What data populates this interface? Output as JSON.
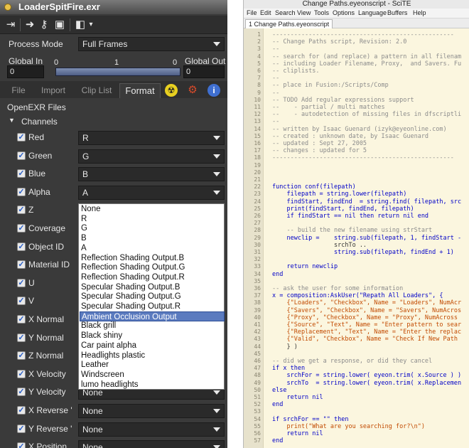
{
  "fusion": {
    "title": "LoaderSpitFire.exr",
    "process_mode": {
      "label": "Process Mode",
      "value": "Full Frames"
    },
    "global_in": {
      "label": "Global In",
      "value": "0"
    },
    "global_out": {
      "label": "Global Out",
      "value": "0"
    },
    "range_ticks": [
      "0",
      "1",
      "0"
    ],
    "tabs": [
      "File",
      "Import",
      "Clip List",
      "Format"
    ],
    "section": "OpenEXR Files",
    "group": "Channels",
    "channels": [
      {
        "label": "Red",
        "value": "R"
      },
      {
        "label": "Green",
        "value": "G"
      },
      {
        "label": "Blue",
        "value": "B"
      },
      {
        "label": "Alpha",
        "value": "A"
      },
      {
        "label": "Z",
        "value": ""
      },
      {
        "label": "Coverage",
        "value": ""
      },
      {
        "label": "Object ID",
        "value": ""
      },
      {
        "label": "Material ID",
        "value": ""
      },
      {
        "label": "U",
        "value": ""
      },
      {
        "label": "V",
        "value": ""
      },
      {
        "label": "X Normal",
        "value": ""
      },
      {
        "label": "Y Normal",
        "value": ""
      },
      {
        "label": "Z Normal",
        "value": ""
      },
      {
        "label": "X Velocity",
        "value": ""
      },
      {
        "label": "Y Velocity",
        "value": "None"
      },
      {
        "label": "X Reverse '",
        "value": "None"
      },
      {
        "label": "Y Reverse '",
        "value": "None"
      },
      {
        "label": "X Position",
        "value": "None"
      }
    ],
    "popup_options": [
      "None",
      "R",
      "G",
      "B",
      "A",
      "Reflection Shading Output.B",
      "Reflection Shading Output.G",
      "Reflection Shading Output.R",
      "Specular Shading Output.B",
      "Specular Shading Output.G",
      "Specular Shading Output.R",
      "Ambient Occlusion Output",
      "Black grill",
      "Black shiny",
      "Car paint alpha",
      "Headlights plastic",
      "Leather",
      "Windscreen",
      "lumo headlights"
    ],
    "popup_selected_index": 11
  },
  "scite": {
    "window_title": "Change Paths.eyeonscript - SciTE",
    "menu": [
      "File",
      "Edit",
      "Search",
      "View",
      "Tools",
      "Options",
      "Language",
      "Buffers",
      "Help"
    ],
    "tab": "1 Change Paths.eyeonscript",
    "lines": [
      {
        "n": "1",
        "t": "--------------------------------------------------",
        "s": "c"
      },
      {
        "n": "2",
        "t": "-- Change Paths script, Revision: 2.0",
        "s": "c"
      },
      {
        "n": "3",
        "t": "--",
        "s": "c"
      },
      {
        "n": "4",
        "t": "-- search for (and replace) a pattern in all filenam",
        "s": "c"
      },
      {
        "n": "5",
        "t": "-- including Loader Filename, Proxy,  and Savers. Fu",
        "s": "c"
      },
      {
        "n": "6",
        "t": "-- cliplists.",
        "s": "c"
      },
      {
        "n": "7",
        "t": "--",
        "s": "c"
      },
      {
        "n": "8",
        "t": "-- place in Fusion:/Scripts/Comp",
        "s": "c"
      },
      {
        "n": "9",
        "t": "--",
        "s": "c"
      },
      {
        "n": "10",
        "t": "-- TODO Add regular expressions support",
        "s": "c"
      },
      {
        "n": "11",
        "t": "--    - partial / multi matches",
        "s": "c"
      },
      {
        "n": "12",
        "t": "--    - autodetection of missing files in dfscriptli",
        "s": "c"
      },
      {
        "n": "13",
        "t": "--",
        "s": "c"
      },
      {
        "n": "14",
        "t": "-- written by Isaac Guenard (izyk@eyeonline.com)",
        "s": "c"
      },
      {
        "n": "15",
        "t": "-- created : unknown date, by Isaac Guenard",
        "s": "c"
      },
      {
        "n": "16",
        "t": "-- updated : Sept 27, 2005",
        "s": "c"
      },
      {
        "n": "17",
        "t": "-- changes : updated for 5",
        "s": "c"
      },
      {
        "n": "18",
        "t": "--------------------------------------------------",
        "s": "c"
      },
      {
        "n": "19",
        "t": "",
        "s": ""
      },
      {
        "n": "20",
        "t": "",
        "s": ""
      },
      {
        "n": "21",
        "t": "",
        "s": ""
      },
      {
        "n": "22",
        "t": "function conf(filepath)",
        "s": "k"
      },
      {
        "n": "23",
        "t": "    filepath = string.lower(filepath)",
        "s": "k"
      },
      {
        "n": "24",
        "t": "    findStart, findEnd  = string.find( filepath, src",
        "s": "k"
      },
      {
        "n": "25",
        "t": "    print(findStart, findEnd, filepath)",
        "s": "k"
      },
      {
        "n": "26",
        "t": "    if findStart == nil then return nil end",
        "s": "k"
      },
      {
        "n": "27",
        "t": "",
        "s": ""
      },
      {
        "n": "28",
        "t": "    -- build the new filename using strStart",
        "s": "c"
      },
      {
        "n": "29",
        "t": "    newclip =    string.sub(filepath, 1, findStart -",
        "s": "k"
      },
      {
        "n": "30",
        "t": "                 srchTo ..",
        "s": ""
      },
      {
        "n": "31",
        "t": "                 string.sub(filepath, findEnd + 1)",
        "s": "k"
      },
      {
        "n": "32",
        "t": "",
        "s": ""
      },
      {
        "n": "33",
        "t": "    return newclip",
        "s": "k"
      },
      {
        "n": "34",
        "t": "end",
        "s": "k"
      },
      {
        "n": "35",
        "t": "",
        "s": ""
      },
      {
        "n": "36",
        "t": "-- ask the user for some information",
        "s": "c"
      },
      {
        "n": "37",
        "t": "x = composition:AskUser(\"Repath All Loaders\", {",
        "s": "k"
      },
      {
        "n": "38",
        "t": "    {\"Loaders\", \"Checkbox\", Name = \"Loaders\", NumAcr",
        "s": "s"
      },
      {
        "n": "39",
        "t": "    {\"Savers\", \"Checkbox\", Name = \"Savers\", NumAcros",
        "s": "s"
      },
      {
        "n": "40",
        "t": "    {\"Proxy\", \"Checkbox\", Name = \"Proxy\", NumAcross",
        "s": "s"
      },
      {
        "n": "41",
        "t": "    {\"Source\", \"Text\", Name = \"Enter pattern to sear",
        "s": "s"
      },
      {
        "n": "42",
        "t": "    {\"Replacement\", \"Text\", Name = \"Enter the replac",
        "s": "s"
      },
      {
        "n": "43",
        "t": "    {\"Valid\", \"Checkbox\", Name = \"Check If New Path",
        "s": "s"
      },
      {
        "n": "44",
        "t": "    } )",
        "s": ""
      },
      {
        "n": "45",
        "t": "",
        "s": ""
      },
      {
        "n": "46",
        "t": "-- did we get a response, or did they cancel",
        "s": "c"
      },
      {
        "n": "47",
        "t": "if x then",
        "s": "k"
      },
      {
        "n": "48",
        "t": "    srchFor = string.lower( eyeon.trim( x.Source ) )",
        "s": "k"
      },
      {
        "n": "49",
        "t": "    srchTo  = string.lower( eyeon.trim( x.Replacemen",
        "s": "k"
      },
      {
        "n": "50",
        "t": "else",
        "s": "k"
      },
      {
        "n": "51",
        "t": "    return nil",
        "s": "k"
      },
      {
        "n": "52",
        "t": "end",
        "s": "k"
      },
      {
        "n": "53",
        "t": "",
        "s": ""
      },
      {
        "n": "54",
        "t": "if srchFor == \"\" then",
        "s": "k"
      },
      {
        "n": "55",
        "t": "    print(\"What are you searching for?\\n\")",
        "s": "s"
      },
      {
        "n": "56",
        "t": "    return nil",
        "s": "k"
      },
      {
        "n": "57",
        "t": "end",
        "s": "k"
      }
    ]
  }
}
